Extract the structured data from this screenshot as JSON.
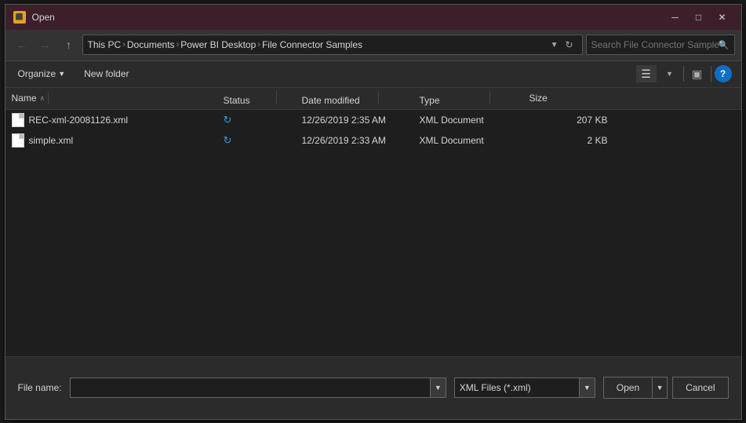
{
  "dialog": {
    "title": "Open",
    "icon_label": "PBI"
  },
  "nav": {
    "back_title": "Back",
    "forward_title": "Forward",
    "up_title": "Up",
    "address": {
      "this_pc": "This PC",
      "documents": "Documents",
      "power_bi": "Power BI Desktop",
      "folder": "File Connector Samples"
    },
    "search_placeholder": "Search File Connector Samples"
  },
  "toolbar": {
    "organize_label": "Organize",
    "new_folder_label": "New folder",
    "help_label": "?"
  },
  "columns": {
    "name": "Name",
    "status": "Status",
    "date_modified": "Date modified",
    "type": "Type",
    "size": "Size"
  },
  "files": [
    {
      "name": "REC-xml-20081126.xml",
      "status": "↻",
      "date_modified": "12/26/2019 2:35 AM",
      "type": "XML Document",
      "size": "207 KB"
    },
    {
      "name": "simple.xml",
      "status": "↻",
      "date_modified": "12/26/2019 2:33 AM",
      "type": "XML Document",
      "size": "2 KB"
    }
  ],
  "bottom": {
    "filename_label": "File name:",
    "filename_value": "",
    "filetype_value": "XML Files (*.xml)",
    "open_label": "Open",
    "cancel_label": "Cancel"
  }
}
